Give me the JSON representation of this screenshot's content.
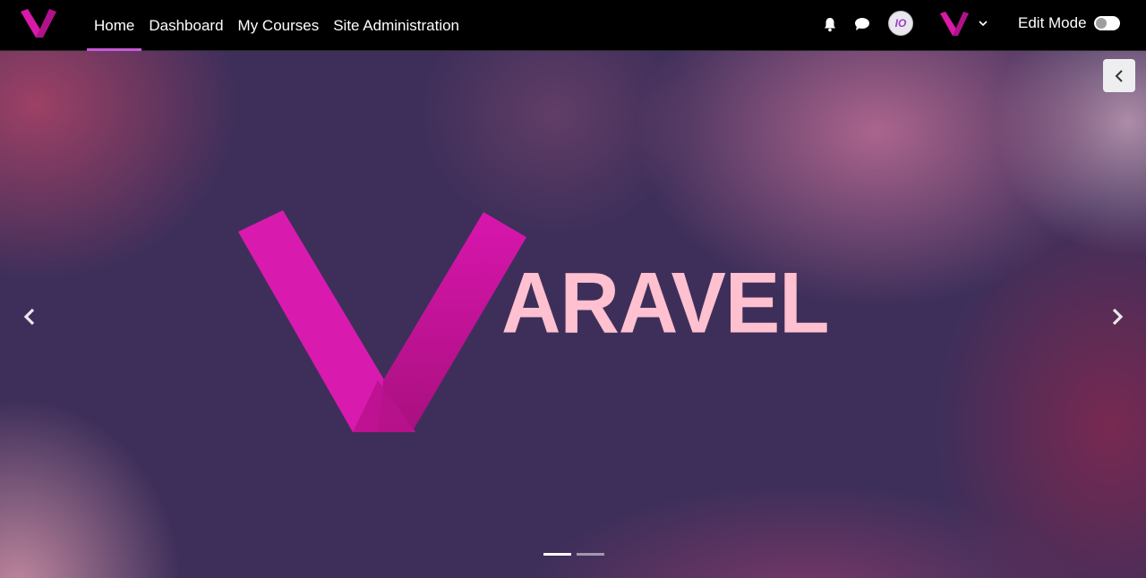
{
  "brand": {
    "logo_icon": "varavel-v-logo",
    "accent_color": "#d81aa8"
  },
  "nav": {
    "items": [
      {
        "label": "Home",
        "active": true
      },
      {
        "label": "Dashboard",
        "active": false
      },
      {
        "label": "My Courses",
        "active": false
      },
      {
        "label": "Site Administration",
        "active": false
      }
    ],
    "active_underline_color": "#c45ad7"
  },
  "header_actions": {
    "notifications_icon": "bell-icon",
    "messages_icon": "chat-bubble-icon",
    "avatar_initials": "IO",
    "user_menu_icon": "varavel-v-logo",
    "user_menu_chevron": "chevron-down-icon",
    "edit_mode_label": "Edit Mode",
    "edit_mode_on": false
  },
  "hero": {
    "wordmark": "ARAVEL",
    "wordmark_color": "#ffc0d0",
    "slides_total": 2,
    "active_slide": 1,
    "prev_icon": "chevron-left-icon",
    "next_icon": "chevron-right-icon",
    "drawer_icon": "chevron-left-icon"
  }
}
